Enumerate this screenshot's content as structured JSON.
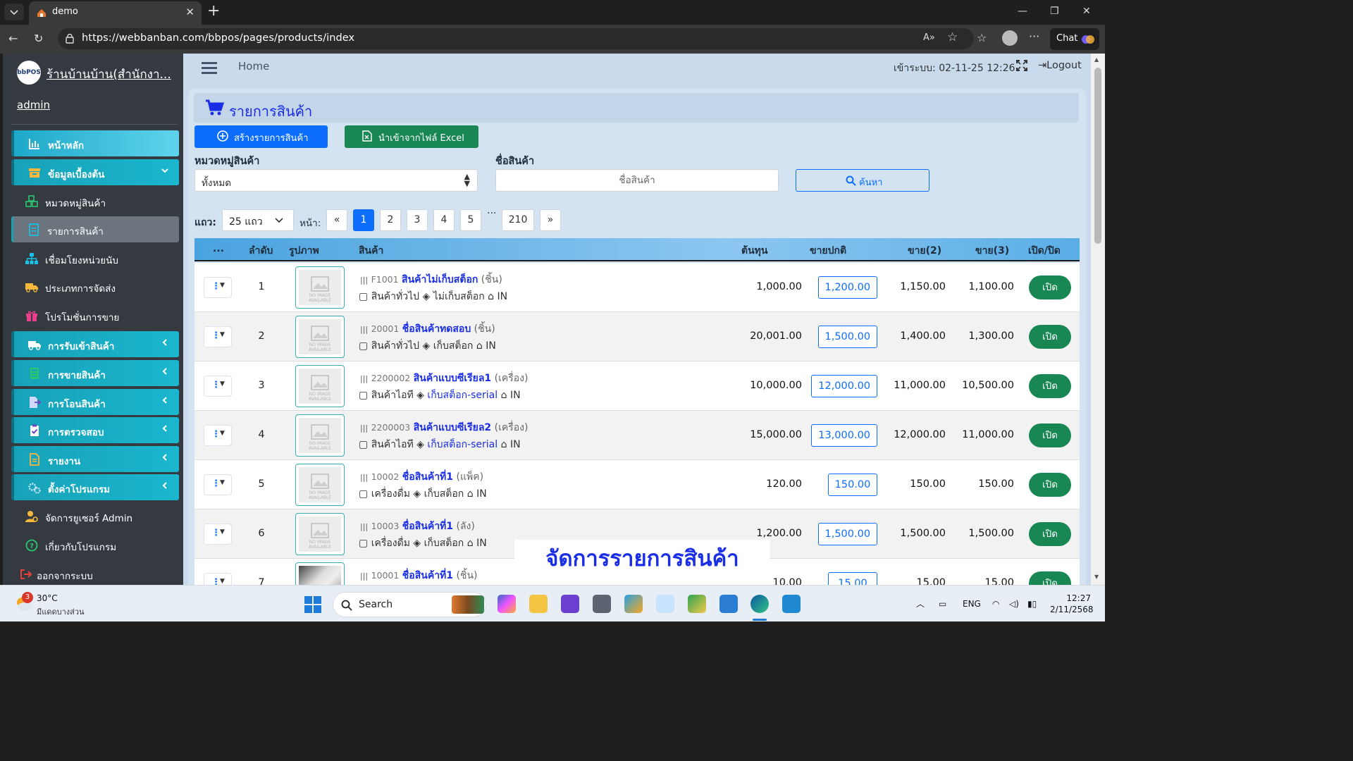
{
  "browser": {
    "tab_title": "demo",
    "url": "https://webbanban.com/bbpos/pages/products/index",
    "chat_label": "Chat"
  },
  "sidebar": {
    "brand_logo_text": "bbPOS",
    "brand_name": "ร้านบ้านบ้าน(สำนักงา...",
    "user": "admin",
    "items": [
      {
        "label": "หน้าหลัก",
        "icon": "chart-bar-icon"
      },
      {
        "label": "ข้อมูลเบื้องต้น",
        "icon": "archive-box-icon"
      },
      {
        "label": "หมวดหมู่สินค้า",
        "icon": "cubes-icon"
      },
      {
        "label": "รายการสินค้า",
        "icon": "file-list-icon"
      },
      {
        "label": "เชื่อมโยงหน่วยนับ",
        "icon": "sitemap-icon"
      },
      {
        "label": "ประเภทการจัดส่ง",
        "icon": "truck-icon"
      },
      {
        "label": "โปรโมชั่นการขาย",
        "icon": "gift-icon"
      },
      {
        "label": "การรับเข้าสินค้า",
        "icon": "truck-loading-icon"
      },
      {
        "label": "การขายสินค้า",
        "icon": "calculator-icon"
      },
      {
        "label": "การโอนสินค้า",
        "icon": "file-export-icon"
      },
      {
        "label": "การตรวจสอบ",
        "icon": "clipboard-check-icon"
      },
      {
        "label": "รายงาน",
        "icon": "report-icon"
      },
      {
        "label": "ตั้งค่าโปรแกรม",
        "icon": "cogs-icon"
      },
      {
        "label": "จัดการยูเซอร์ Admin",
        "icon": "user-cog-icon"
      },
      {
        "label": "เกี่ยวกับโปรแกรม",
        "icon": "question-circle-icon"
      },
      {
        "label": "ออกจากระบบ",
        "icon": "sign-out-icon"
      }
    ]
  },
  "topbar": {
    "home": "Home",
    "login_time": "เข้าระบบ: 02-11-25 12:26",
    "logout": "Logout"
  },
  "page": {
    "title": "รายการสินค้า",
    "create_button": "สร้างรายการสินค้า",
    "import_button": "นำเข้าจากไฟล์ Excel",
    "category_label": "หมวดหมู่สินค้า",
    "category_value": "ทั้งหมด",
    "name_label": "ชื่อสินค้า",
    "name_placeholder": "ชื่อสินค้า",
    "search_button": "ค้นหา",
    "rows_label": "แถว:",
    "rows_value": "25 แถว",
    "page_label": "หน้า:",
    "pagination": {
      "prev": "«",
      "pages": [
        "1",
        "2",
        "3",
        "4",
        "5"
      ],
      "dots": "...",
      "last": "210",
      "next": "»",
      "current": "1"
    }
  },
  "table": {
    "headers": {
      "actions": "...",
      "seq": "ลำดับ",
      "image": "รูปภาพ",
      "product": "สินค้า",
      "cost": "ต้นทุน",
      "price": "ขายปกติ",
      "price2": "ขาย(2)",
      "price3": "ขาย(3)",
      "status": "เปิด/ปิด"
    },
    "rows": [
      {
        "seq": "1",
        "code": "F1001",
        "name": "สินค้าไม่เก็บสต็อก",
        "unit": "(ชิ้น)",
        "category": "สินค้าทั่วไป",
        "stock": "ไม่เก็บสต็อก",
        "stock_link": false,
        "tag": "IN",
        "cost": "1,000.00",
        "price": "1,200.00",
        "price2": "1,150.00",
        "price3": "1,100.00",
        "status": "เปิด",
        "has_photo": false
      },
      {
        "seq": "2",
        "code": "20001",
        "name": "ชื่อสินค้าทดสอบ",
        "unit": "(ชิ้น)",
        "category": "สินค้าทั่วไป",
        "stock": "เก็บสต็อก",
        "stock_link": false,
        "tag": "IN",
        "cost": "20,001.00",
        "price": "1,500.00",
        "price2": "1,400.00",
        "price3": "1,300.00",
        "status": "เปิด",
        "has_photo": false
      },
      {
        "seq": "3",
        "code": "2200002",
        "name": "สินค้าแบบซีเรียล1",
        "unit": "(เครื่อง)",
        "category": "สินค้าไอที",
        "stock": "เก็บสต็อก-serial",
        "stock_link": true,
        "tag": "IN",
        "cost": "10,000.00",
        "price": "12,000.00",
        "price2": "11,000.00",
        "price3": "10,500.00",
        "status": "เปิด",
        "has_photo": false
      },
      {
        "seq": "4",
        "code": "2200003",
        "name": "สินค้าแบบซีเรียล2",
        "unit": "(เครื่อง)",
        "category": "สินค้าไอที",
        "stock": "เก็บสต็อก-serial",
        "stock_link": true,
        "tag": "IN",
        "cost": "15,000.00",
        "price": "13,000.00",
        "price2": "12,000.00",
        "price3": "11,000.00",
        "status": "เปิด",
        "has_photo": false
      },
      {
        "seq": "5",
        "code": "10002",
        "name": "ชื่อสินค้าที่1",
        "unit": "(แพ็ค)",
        "category": "เครื่องดื่ม",
        "stock": "เก็บสต็อก",
        "stock_link": false,
        "tag": "IN",
        "cost": "120.00",
        "price": "150.00",
        "price2": "150.00",
        "price3": "150.00",
        "status": "เปิด",
        "has_photo": false
      },
      {
        "seq": "6",
        "code": "10003",
        "name": "ชื่อสินค้าที่1",
        "unit": "(ลัง)",
        "category": "เครื่องดื่ม",
        "stock": "เก็บสต็อก",
        "stock_link": false,
        "tag": "IN",
        "cost": "1,200.00",
        "price": "1,500.00",
        "price2": "1,500.00",
        "price3": "1,500.00",
        "status": "เปิด",
        "has_photo": false
      },
      {
        "seq": "7",
        "code": "10001",
        "name": "ชื่อสินค้าที่1",
        "unit": "(ชิ้น)",
        "category": "",
        "stock": "",
        "stock_link": false,
        "tag": "",
        "cost": "10.00",
        "price": "15.00",
        "price2": "15.00",
        "price3": "15.00",
        "status": "เปิด",
        "has_photo": true
      }
    ],
    "no_image_text": "NO IMAGE AVAILABLE"
  },
  "overlay_caption": "จัดการรายการสินค้า",
  "taskbar": {
    "weather_badge": "3",
    "temperature": "30°C",
    "weather_desc": "มีแดดบางส่วน",
    "search": "Search",
    "language": "ENG",
    "time": "12:27",
    "date": "2/11/2568"
  },
  "colors": {
    "sidebar_bg": "#343a40",
    "nav_primary": "#17a2b8",
    "main_bg": "#c9daec",
    "link_blue": "#1a2ee6",
    "btn_primary": "#0d6efd",
    "btn_success": "#198754"
  }
}
